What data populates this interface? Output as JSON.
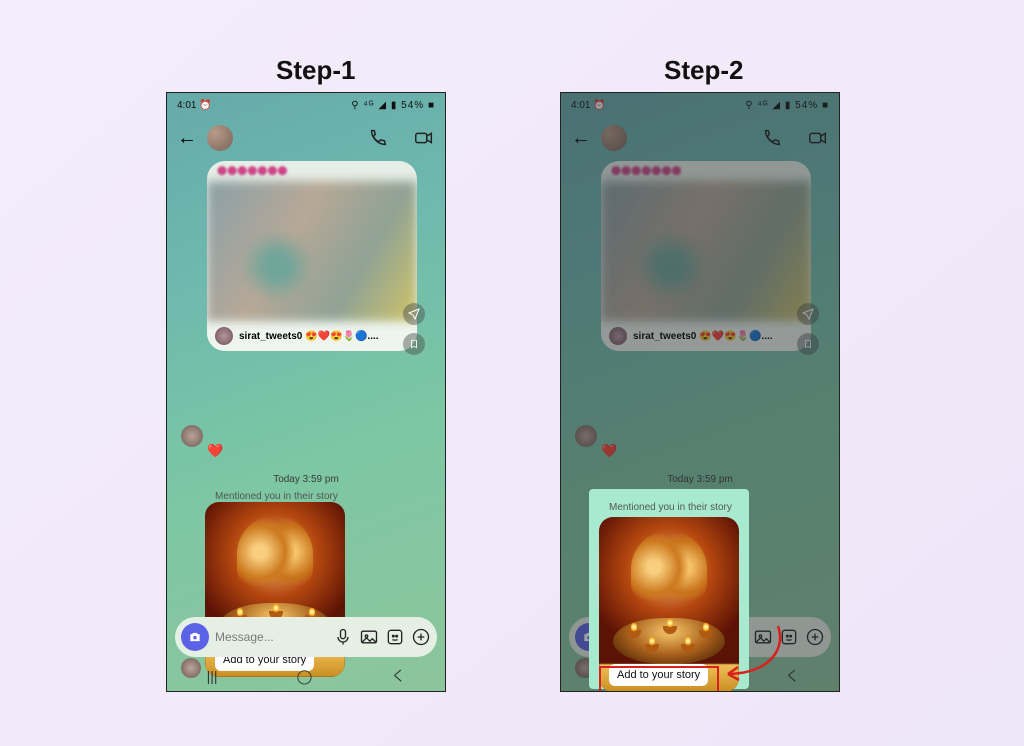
{
  "steps": {
    "step1_label": "Step-1",
    "step2_label": "Step-2"
  },
  "status": {
    "time": "4:01",
    "left_icon": "⏰",
    "indicators": "⚲ ⁴ᴳ ◢ ▮ 54% ■"
  },
  "shared_post": {
    "caption_user": "sirat_tweets0",
    "caption_suffix": "😍❤️😍🌷🔵....",
    "heart": "❤️"
  },
  "chat": {
    "timestamp": "Today 3:59 pm",
    "mentioned_text": "Mentioned you in their story",
    "add_to_story": "Add to your story",
    "input_placeholder": "Message..."
  },
  "nav": {
    "recent": "|||",
    "home": "◯",
    "back": "く"
  }
}
